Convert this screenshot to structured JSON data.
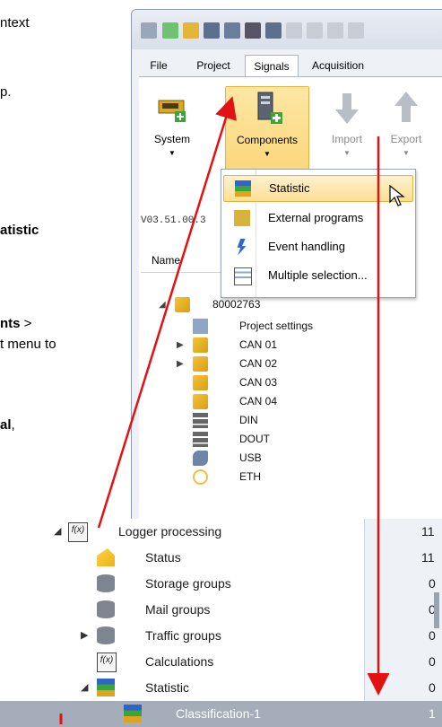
{
  "doc_text": {
    "line1": "ntext",
    "line2": "p.",
    "line3": "atistic",
    "line4": "nts",
    "line4_suffix": " >",
    "line5": "t menu to",
    "line6": "al",
    "line6_suffix": ","
  },
  "menubar": {
    "file": "File",
    "project": "Project",
    "signals": "Signals",
    "acquisition": "Acquisition"
  },
  "ribbon": {
    "system": "System",
    "components": "Components",
    "import": "Import",
    "export": "Export"
  },
  "dropdown": {
    "items": [
      {
        "label": "Statistic",
        "icon": "statistic-icon"
      },
      {
        "label": "External programs",
        "icon": "external-programs-icon"
      },
      {
        "label": "Event handling",
        "icon": "event-handling-icon"
      },
      {
        "label": "Multiple selection...",
        "icon": "multiple-selection-icon"
      }
    ]
  },
  "version": "V03.51.00.3",
  "tree_header": {
    "name": "Name"
  },
  "tree": {
    "device": "80002763",
    "items": [
      {
        "label": "Project settings"
      },
      {
        "label": "CAN 01"
      },
      {
        "label": "CAN 02"
      },
      {
        "label": "CAN 03"
      },
      {
        "label": "CAN 04"
      },
      {
        "label": "DIN"
      },
      {
        "label": "DOUT"
      },
      {
        "label": "USB"
      },
      {
        "label": "ETH"
      }
    ]
  },
  "zoom_tree": {
    "rows": [
      {
        "label": "Logger processing",
        "value": "11"
      },
      {
        "label": "Status",
        "value": "11"
      },
      {
        "label": "Storage groups",
        "value": "0"
      },
      {
        "label": "Mail groups",
        "value": "0"
      },
      {
        "label": "Traffic groups",
        "value": "0"
      },
      {
        "label": "Calculations",
        "value": "0"
      },
      {
        "label": "Statistic",
        "value": "0"
      },
      {
        "label": "Classification-1",
        "value": "1"
      }
    ]
  },
  "colors": {
    "arrow": "#e31212",
    "highlight": "#fbd67a",
    "selected_row": "#a4adb9"
  }
}
